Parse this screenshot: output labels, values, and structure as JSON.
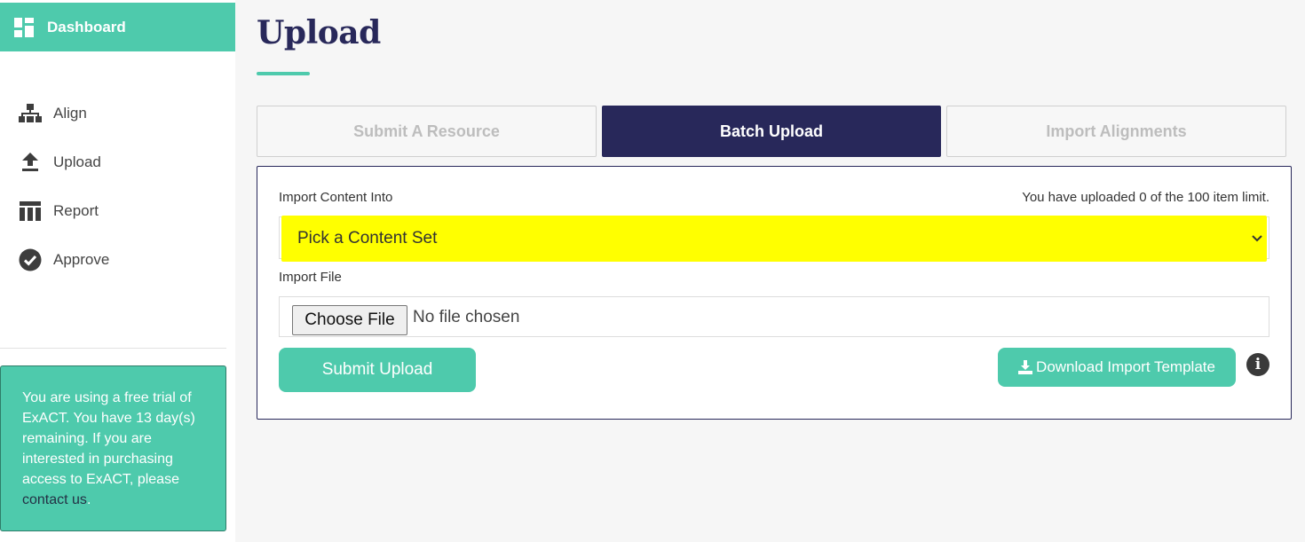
{
  "sidebar": {
    "dashboard_label": "Dashboard",
    "items": [
      {
        "label": "Align",
        "icon": "sitemap-icon"
      },
      {
        "label": "Upload",
        "icon": "upload-icon"
      },
      {
        "label": "Report",
        "icon": "table-icon"
      },
      {
        "label": "Approve",
        "icon": "check-circle-icon"
      }
    ],
    "trial_text": "You are using a free trial of ExACT. You have 13 day(s) remaining. If you are interested in purchasing access to ExACT, please ",
    "trial_link": "contact us",
    "trial_end": "."
  },
  "page": {
    "title": "Upload"
  },
  "tabs": [
    {
      "label": "Submit A Resource",
      "active": false
    },
    {
      "label": "Batch Upload",
      "active": true
    },
    {
      "label": "Import Alignments",
      "active": false
    }
  ],
  "form": {
    "import_into_label": "Import Content Into",
    "limit_text": "You have uploaded 0 of the 100 item limit.",
    "select_value": "Pick a Content Set",
    "import_file_label": "Import File",
    "choose_file_label": "Choose File",
    "no_file_text": "No file chosen",
    "submit_label": "Submit Upload",
    "download_label": "Download Import Template",
    "info_glyph": "i"
  },
  "colors": {
    "accent": "#4ecaac",
    "navy": "#28285a",
    "highlight": "#ffff00"
  }
}
